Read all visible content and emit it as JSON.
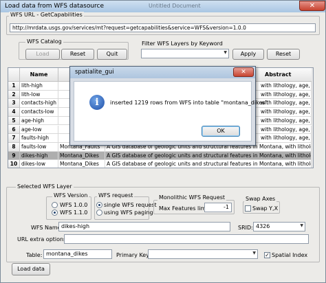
{
  "window": {
    "title": "Load data from WFS datasource",
    "background_text": "Untitled Document"
  },
  "wfs_url": {
    "group_label": "WFS URL - GetCapabilities",
    "value": "http://mrdata.usgs.gov/services/mt?request=getcapabilities&service=WFS&version=1.0.0"
  },
  "catalog": {
    "group_label": "WFS Catalog",
    "load_label": "Load",
    "reset_label": "Reset",
    "quit_label": "Quit"
  },
  "filter": {
    "label": "Filter WFS Layers by Keyword",
    "value": "",
    "apply_label": "Apply",
    "reset_label": "Reset"
  },
  "table": {
    "headers": {
      "name": "Name",
      "abstract": "Abstract"
    },
    "rows": [
      {
        "num": "1",
        "name": "lith-high",
        "abstract": "with lithology, age, data stru"
      },
      {
        "num": "2",
        "name": "lith-low",
        "abstract": "with lithology, age, data stru"
      },
      {
        "num": "3",
        "name": "contacts-high",
        "abstract": "with lithology, age, data stru"
      },
      {
        "num": "4",
        "name": "contacts-low",
        "abstract": "with lithology, age, data stru"
      },
      {
        "num": "5",
        "name": "age-high",
        "abstract": "with lithology, age, data stru"
      },
      {
        "num": "6",
        "name": "age-low",
        "abstract": "with lithology, age, data stru"
      },
      {
        "num": "7",
        "name": "faults-high",
        "abstract": "with lithology, age, data stru"
      },
      {
        "num": "8",
        "name": "faults-low",
        "title": "Montana_Faults",
        "abstract": "A GIS database of geologic units and structural features in Montana, with lithology, age, data stru"
      },
      {
        "num": "9",
        "name": "dikes-high",
        "title": "Montana_Dikes",
        "abstract": "A GIS database of geologic units and structural features in Montana, with lithology, age, data stru"
      },
      {
        "num": "10",
        "name": "dikes-low",
        "title": "Montana_Dikes",
        "abstract": "A GIS database of geologic units and structural features in Montana, with lithology, age, data stru"
      }
    ]
  },
  "selected": {
    "group_label": "Selected WFS Layer",
    "version": {
      "label": "WFS Version",
      "options": [
        "WFS 1.0.0",
        "WFS 1.1.0"
      ],
      "selected": "WFS 1.1.0"
    },
    "request": {
      "label": "WFS request",
      "options": [
        "single WFS request",
        "using WFS paging"
      ],
      "selected": "single WFS request"
    },
    "monolithic": {
      "label": "Monolithic WFS Request",
      "max_label": "Max Features limit:",
      "max_value": "-1"
    },
    "swap": {
      "label": "Swap Axes",
      "checkbox_label": "Swap Y,X",
      "checked": false
    },
    "wfs_name_label": "WFS Name:",
    "wfs_name_value": "dikes-high",
    "srid_label": "SRID:",
    "srid_value": "4326",
    "url_extra_label": "URL extra options:",
    "url_extra_value": "",
    "table_label": "Table:",
    "table_value": "montana_dikes",
    "primary_key_label": "Primary Key:",
    "primary_key_value": "",
    "spatial_index_label": "Spatial Index",
    "spatial_index_checked": true
  },
  "load_data_label": "Load data",
  "dialog": {
    "title": "spatialite_gui",
    "message": "inserted 1219 rows from WFS into table \"montana_dikes\"",
    "ok_label": "OK",
    "icon": "info-icon"
  }
}
